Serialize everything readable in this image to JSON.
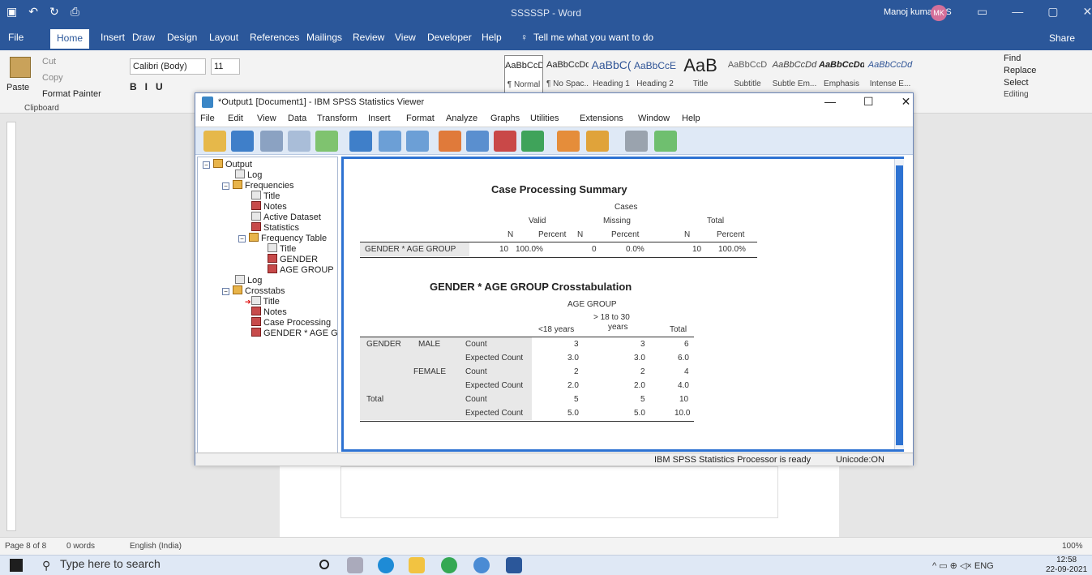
{
  "word": {
    "title": "SSSSSP - Word",
    "user": "Manoj kumar A.S",
    "avatar_initials": "MK",
    "tabs": [
      "File",
      "Home",
      "Insert",
      "Draw",
      "Design",
      "Layout",
      "References",
      "Mailings",
      "Review",
      "View",
      "Developer",
      "Help"
    ],
    "tell_me": "Tell me what you want to do",
    "share": "Share",
    "clipboard": {
      "paste": "Paste",
      "cut": "Cut",
      "copy": "Copy",
      "format_painter": "Format Painter",
      "group": "Clipboard"
    },
    "font": {
      "name": "Calibri (Body)",
      "size": "11"
    },
    "styles": [
      {
        "preview": "AaBbCcDd",
        "name": "¶ Normal"
      },
      {
        "preview": "AaBbCcDd",
        "name": "¶ No Spac..."
      },
      {
        "preview": "AaBbC(",
        "name": "Heading 1"
      },
      {
        "preview": "AaBbCcE",
        "name": "Heading 2"
      },
      {
        "preview": "AaB",
        "name": "Title"
      },
      {
        "preview": "AaBbCcD",
        "name": "Subtitle"
      },
      {
        "preview": "AaBbCcDd",
        "name": "Subtle Em..."
      },
      {
        "preview": "AaBbCcDd",
        "name": "Emphasis"
      },
      {
        "preview": "AaBbCcDd",
        "name": "Intense E..."
      }
    ],
    "editing": {
      "find": "Find",
      "replace": "Replace",
      "select": "Select",
      "group": "Editing"
    },
    "status": {
      "page": "Page 8 of 8",
      "words": "0 words",
      "lang": "English (India)",
      "zoom": "100%"
    },
    "taskbar": {
      "search": "Type here to search",
      "lang": "ENG",
      "time": "12:58",
      "date": "22-09-2021"
    }
  },
  "spss": {
    "title": "*Output1 [Document1] - IBM SPSS Statistics Viewer",
    "menu": [
      "File",
      "Edit",
      "View",
      "Data",
      "Transform",
      "Insert",
      "Format",
      "Analyze",
      "Graphs",
      "Utilities",
      "Extensions",
      "Window",
      "Help"
    ],
    "outline": [
      {
        "label": "Output",
        "level": 0
      },
      {
        "label": "Log",
        "level": 1
      },
      {
        "label": "Frequencies",
        "level": 1
      },
      {
        "label": "Title",
        "level": 2
      },
      {
        "label": "Notes",
        "level": 2
      },
      {
        "label": "Active Dataset",
        "level": 2
      },
      {
        "label": "Statistics",
        "level": 2
      },
      {
        "label": "Frequency Table",
        "level": 2
      },
      {
        "label": "Title",
        "level": 3
      },
      {
        "label": "GENDER",
        "level": 3
      },
      {
        "label": "AGE GROUP",
        "level": 3
      },
      {
        "label": "Log",
        "level": 1
      },
      {
        "label": "Crosstabs",
        "level": 1
      },
      {
        "label": "Title",
        "level": 2
      },
      {
        "label": "Notes",
        "level": 2
      },
      {
        "label": "Case Processing",
        "level": 2
      },
      {
        "label": "GENDER * AGE G",
        "level": 2
      }
    ],
    "case_summary": {
      "title": "Case Processing Summary",
      "cases": "Cases",
      "groups": [
        "Valid",
        "Missing",
        "Total"
      ],
      "subcols": [
        "N",
        "Percent",
        "N",
        "Percent",
        "N",
        "Percent"
      ],
      "row_label": "GENDER * AGE GROUP",
      "row": [
        "10",
        "100.0%",
        "0",
        "0.0%",
        "10",
        "100.0%"
      ]
    },
    "crosstab": {
      "title": "GENDER * AGE GROUP Crosstabulation",
      "age_group": "AGE GROUP",
      "col1": "<18 years",
      "col2a": "> 18 to 30",
      "col2b": "years",
      "total_col": "Total",
      "gender": "GENDER",
      "male": "MALE",
      "female": "FEMALE",
      "total_row": "Total",
      "count": "Count",
      "expected": "Expected Count",
      "rows": [
        [
          "3",
          "3",
          "6"
        ],
        [
          "3.0",
          "3.0",
          "6.0"
        ],
        [
          "2",
          "2",
          "4"
        ],
        [
          "2.0",
          "2.0",
          "4.0"
        ],
        [
          "5",
          "5",
          "10"
        ],
        [
          "5.0",
          "5.0",
          "10.0"
        ]
      ]
    },
    "status": {
      "processor": "IBM SPSS Statistics Processor is ready",
      "unicode": "Unicode:ON"
    }
  }
}
